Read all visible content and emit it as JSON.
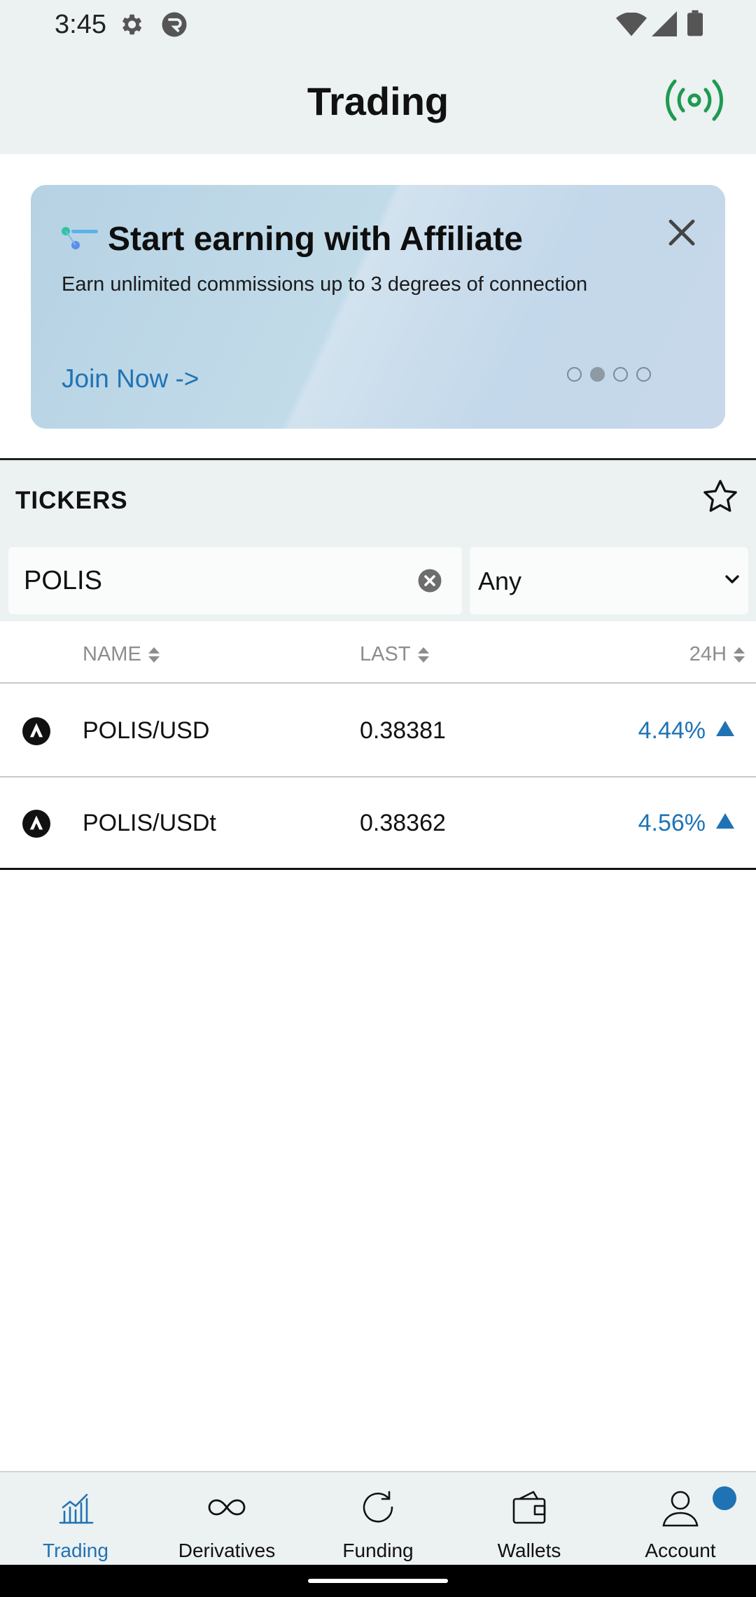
{
  "status_bar": {
    "time": "3:45"
  },
  "header": {
    "title": "Trading"
  },
  "banner": {
    "title": "Start earning with Affiliate",
    "subtitle": "Earn unlimited commissions up to 3 degrees of connection",
    "cta": "Join Now ->",
    "slides_total": 4,
    "active_slide_index": 1
  },
  "tickers": {
    "label": "TICKERS",
    "search": {
      "value": "POLIS"
    },
    "filter": {
      "selected": "Any"
    },
    "columns": {
      "name": "NAME",
      "last": "LAST",
      "change": "24H"
    },
    "rows": [
      {
        "pair": "POLIS/USD",
        "last": "0.38381",
        "change": "4.44%",
        "direction": "up"
      },
      {
        "pair": "POLIS/USDt",
        "last": "0.38362",
        "change": "4.56%",
        "direction": "up"
      }
    ]
  },
  "bottom_nav": {
    "items": [
      {
        "label": "Trading",
        "icon": "chart-icon",
        "active": true
      },
      {
        "label": "Derivatives",
        "icon": "infinity-icon",
        "active": false
      },
      {
        "label": "Funding",
        "icon": "refresh-icon",
        "active": false
      },
      {
        "label": "Wallets",
        "icon": "wallet-icon",
        "active": false
      },
      {
        "label": "Account",
        "icon": "user-icon",
        "active": false,
        "badge": true
      }
    ]
  },
  "colors": {
    "accent": "#1f73b5",
    "live": "#1e9a52",
    "header_bg": "#ecf1f1"
  }
}
